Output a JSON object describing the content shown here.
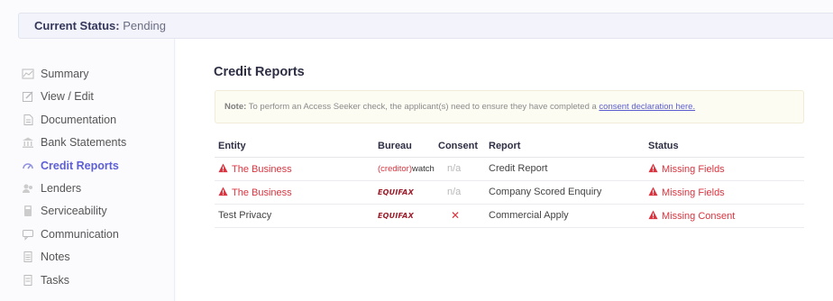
{
  "status_bar": {
    "label": "Current Status:",
    "value": "Pending"
  },
  "sidebar": {
    "items": [
      {
        "label": "Summary",
        "icon": "chart-icon",
        "active": false
      },
      {
        "label": "View / Edit",
        "icon": "edit-icon",
        "active": false
      },
      {
        "label": "Documentation",
        "icon": "document-icon",
        "active": false
      },
      {
        "label": "Bank Statements",
        "icon": "bank-icon",
        "active": false
      },
      {
        "label": "Credit Reports",
        "icon": "credit-report-icon",
        "active": true
      },
      {
        "label": "Lenders",
        "icon": "lenders-icon",
        "active": false
      },
      {
        "label": "Serviceability",
        "icon": "calculator-icon",
        "active": false
      },
      {
        "label": "Communication",
        "icon": "communication-icon",
        "active": false
      },
      {
        "label": "Notes",
        "icon": "notes-icon",
        "active": false
      },
      {
        "label": "Tasks",
        "icon": "tasks-icon",
        "active": false
      }
    ]
  },
  "main": {
    "title": "Credit Reports",
    "note": {
      "prefix": "Note:",
      "text": " To perform an Access Seeker check, the applicant(s) need to ensure they have completed a ",
      "link": "consent declaration here."
    },
    "table": {
      "headers": {
        "entity": "Entity",
        "bureau": "Bureau",
        "consent": "Consent",
        "report": "Report",
        "status": "Status"
      },
      "rows": [
        {
          "entity": "The Business",
          "entity_error": true,
          "bureau": "creditorwatch",
          "bureau_logo_left": "(creditor)",
          "bureau_logo_right": "watch",
          "consent": "n/a",
          "report": "Credit Report",
          "status": "Missing Fields"
        },
        {
          "entity": "The Business",
          "entity_error": true,
          "bureau": "equifax",
          "bureau_logo": "EQUIFAX",
          "consent": "n/a",
          "report": "Company Scored Enquiry",
          "status": "Missing Fields"
        },
        {
          "entity": "Test Privacy",
          "entity_error": false,
          "bureau": "equifax",
          "bureau_logo": "EQUIFAX",
          "consent": "✕",
          "report": "Commercial Apply",
          "status": "Missing Consent"
        }
      ]
    }
  },
  "colors": {
    "accent": "#5d5fd6",
    "error": "#d9343f",
    "equifax": "#9c1c2a"
  }
}
